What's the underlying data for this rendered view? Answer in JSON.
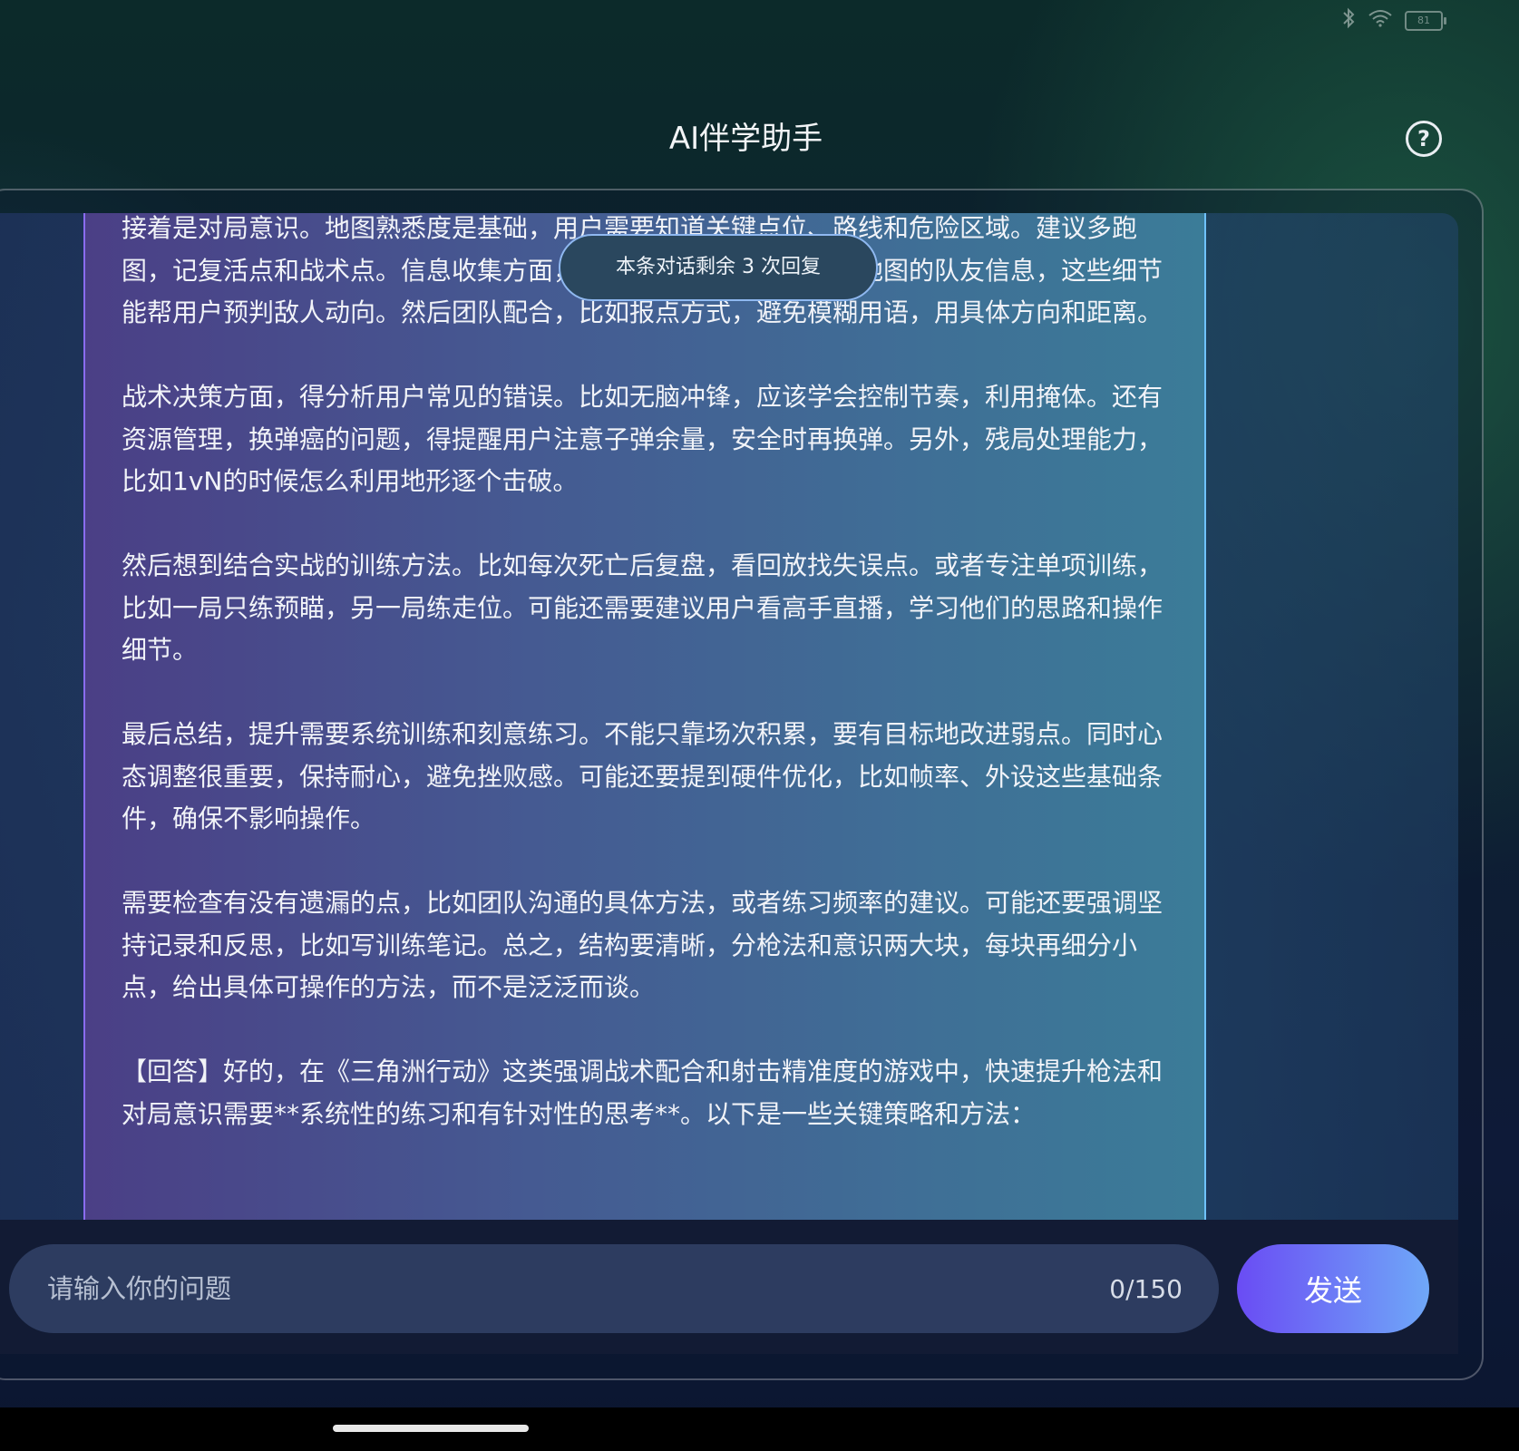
{
  "status_bar": {
    "bluetooth_icon": "bluetooth-icon",
    "wifi_icon": "wifi-icon",
    "battery_level": "81"
  },
  "header": {
    "title": "AI伴学助手",
    "help_icon": "question-circle-icon"
  },
  "notice": {
    "remaining_text": "本条对话剩余 3 次回复"
  },
  "message": {
    "paragraphs": [
      "接着是对局意识。地图熟悉度是基础，用户需要知道关键点位、路线和危险区域。建议多跑图，记复活点和战术点。信息收集方面，要注意听脚步声方向，小地图的队友信息，这些细节能帮用户预判敌人动向。然后团队配合，比如报点方式，避免模糊用语，用具体方向和距离。",
      "战术决策方面，得分析用户常见的错误。比如无脑冲锋，应该学会控制节奏，利用掩体。还有资源管理，换弹癌的问题，得提醒用户注意子弹余量，安全时再换弹。另外，残局处理能力，比如1vN的时候怎么利用地形逐个击破。",
      "然后想到结合实战的训练方法。比如每次死亡后复盘，看回放找失误点。或者专注单项训练，比如一局只练预瞄，另一局练走位。可能还需要建议用户看高手直播，学习他们的思路和操作细节。",
      "最后总结，提升需要系统训练和刻意练习。不能只靠场次积累，要有目标地改进弱点。同时心态调整很重要，保持耐心，避免挫败感。可能还要提到硬件优化，比如帧率、外设这些基础条件，确保不影响操作。",
      "需要检查有没有遗漏的点，比如团队沟通的具体方法，或者练习频率的建议。可能还要强调坚持记录和反思，比如写训练笔记。总之，结构要清晰，分枪法和意识两大块，每块再细分小点，给出具体可操作的方法，而不是泛泛而谈。",
      "【回答】好的，在《三角洲行动》这类强调战术配合和射击精准度的游戏中，快速提升枪法和对局意识需要**系统性的练习和有针对性的思考**。以下是一些关键策略和方法："
    ]
  },
  "input": {
    "placeholder": "请输入你的问题",
    "value": "",
    "char_count": "0/150",
    "send_label": "发送"
  },
  "colors": {
    "send_gradient_start": "#6a4cf4",
    "send_gradient_end": "#6fa8f8",
    "bubble_left": "#4b3f86",
    "bubble_right": "#3b7c98"
  }
}
